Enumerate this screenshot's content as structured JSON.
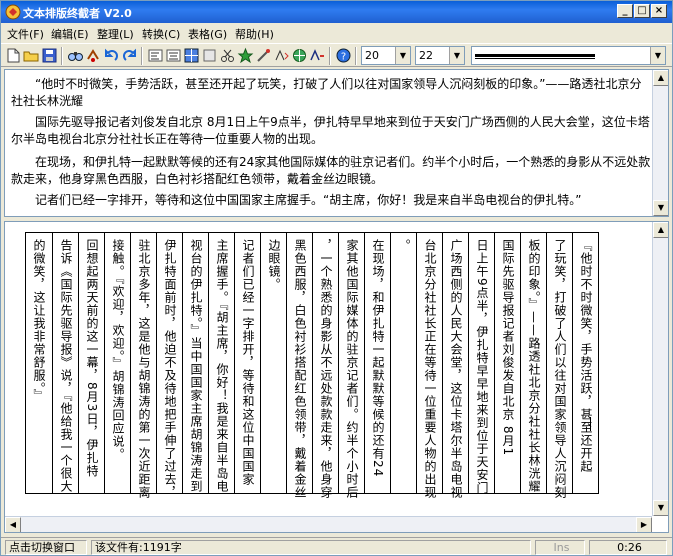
{
  "window": {
    "title": "文本排版终截者 V2.0",
    "minimize": "_",
    "maximize": "□",
    "close": "×"
  },
  "menu": [
    {
      "label": "文件(F)"
    },
    {
      "label": "编辑(E)"
    },
    {
      "label": "整理(L)"
    },
    {
      "label": "转换(C)"
    },
    {
      "label": "表格(G)"
    },
    {
      "label": "帮助(H)"
    }
  ],
  "toolbar": {
    "font_size_value": "20",
    "line_spacing_value": "22"
  },
  "top_text": [
    "“他时不时微笑，手势活跃，甚至还开起了玩笑，打破了人们以往对国家领导人沉闷刻板的印象。”——路透社北京分社社长林洸耀",
    "国际先驱导报记者刘俊发自北京  8月1日上午9点半，伊扎特早早地来到位于天安门广场西侧的人民大会堂，这位卡塔尔半岛电视台北京分社社长正在等待一位重要人物的出现。",
    "在现场，和伊扎特一起默默等候的还有24家其他国际媒体的驻京记者们。约半个小时后，一个熟悉的身影从不远处款款走来，他身穿黑色西服，白色衬衫搭配红色领带，戴着金丝边眼镜。",
    "记者们已经一字排开，等待和这位中国国家主席握手。“胡主席，你好！我是来自半岛电视台的伊扎特。”"
  ],
  "vertical_columns": [
    "『他时不时微笑，手势活跃，甚至还开起",
    "了玩笑，打破了人们以往对国家领导人沉闷刻",
    "板的印象。』——路透社北京分社社长林洸耀",
    "国际先驱导报记者刘俊发自北京  8月1",
    "日上午9点半，伊扎特早早地来到位于天安门",
    "广场西侧的人民大会堂，这位卡塔尔半岛电视",
    "台北京分社社长正在等待一位重要人物的出现",
    "。",
    "在现场，和伊扎特一起默默等候的还有24",
    "家其他国际媒体的驻京记者们。约半个小时后",
    "，一个熟悉的身影从不远处款款走来，他身穿",
    "黑色西服，白色衬衫搭配红色领带，戴着金丝",
    "边眼镜。",
    "记者们已经一字排开，等待和这位中国国家",
    "主席握手。『胡主席，你好！我是来自半岛电",
    "视台的伊扎特。』当中国国家主席胡锦涛走到",
    "伊扎特面前时，他迫不及待地把手伸了过去，",
    "驻北京多年，这是他与胡锦涛的第一次近距离",
    "接触。『欢迎，欢迎。』胡锦涛回应说。",
    "回想起两天前的这一幕，8月3日，伊扎特",
    "告诉《国际先驱导报》说，『他给我一个很大",
    "的微笑，这让我非常舒服。』"
  ],
  "status": {
    "hint": "点击切换窗口",
    "count": "该文件有:1191字",
    "ins": "Ins",
    "time": "0:26"
  }
}
